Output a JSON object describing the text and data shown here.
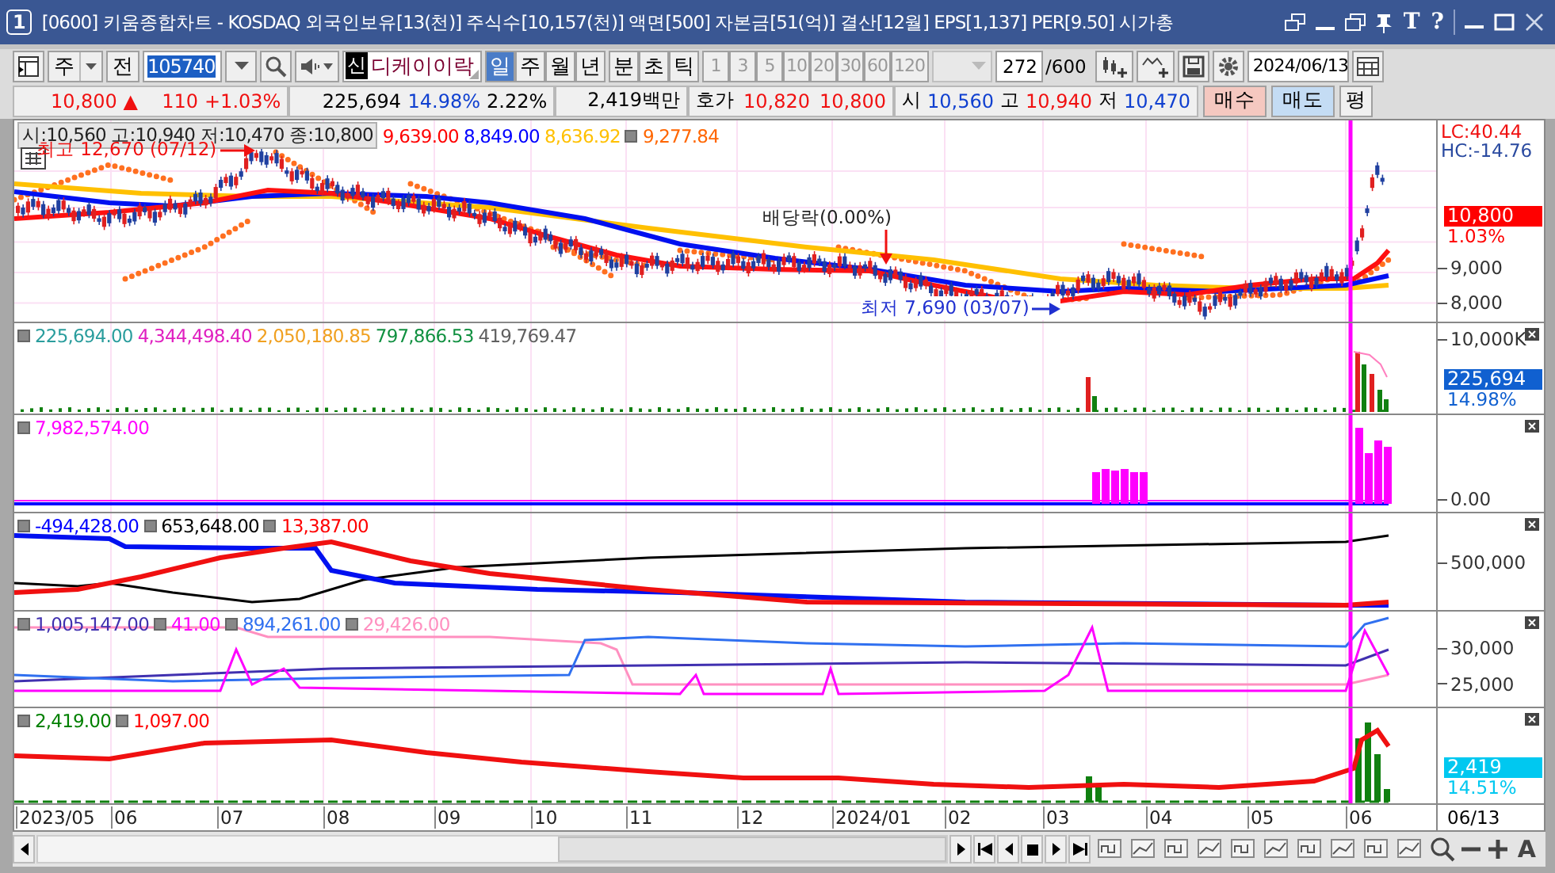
{
  "window": {
    "number": "1",
    "title": "[0600] 키움종합차트 - KOSDAQ 외국인보유[13(천)] 주식수[10,157(천)] 액면[500] 자본금[51(억)] 결산[12월] EPS[1,137] PER[9.50] 시가총",
    "title_buttons": [
      "T",
      "?"
    ]
  },
  "toolbar": {
    "period_type": "주",
    "prev": "전",
    "code": "105740",
    "name_tag": "신",
    "stock_name": "디케이이락",
    "periods": [
      {
        "label": "일",
        "selected": true
      },
      {
        "label": "주",
        "selected": false
      },
      {
        "label": "월",
        "selected": false
      },
      {
        "label": "년",
        "selected": false
      }
    ],
    "units": [
      "분",
      "초",
      "틱"
    ],
    "intervals": [
      "1",
      "3",
      "5",
      "10",
      "20",
      "30",
      "60",
      "120"
    ],
    "count": "272",
    "total": "/600",
    "date": "2024/06/13"
  },
  "quote": {
    "price": "10,800",
    "arrow": "▲",
    "change": "110",
    "change_rate": "+1.03%",
    "volume": "225,694",
    "volume_rate": "14.98%",
    "turnover": "2.22%",
    "amount": "2,419백만",
    "ask_label": "호가",
    "ask": "10,820",
    "bid": "10,800",
    "open_label": "시",
    "open": "10,560",
    "high_label": "고",
    "high": "10,940",
    "low_label": "저",
    "low": "10,470",
    "buy": "매수",
    "sell": "매도",
    "eval": "평"
  },
  "panes": [
    {
      "kind": "price",
      "ohlc": "시:10,560 고:10,940 저:10,470 종:10,800",
      "legends": [
        {
          "text": "9,639.00",
          "color": "#ff0000",
          "marker": false
        },
        {
          "text": "8,849.00",
          "color": "#0000ff",
          "marker": false
        },
        {
          "text": "8,636.92",
          "color": "#ffc000",
          "marker": false
        },
        {
          "text": "9,277.84",
          "color": "#ff6600",
          "marker": true
        }
      ],
      "annotations": [
        {
          "kind": "high",
          "text": "최고 12,670 (07/12)"
        },
        {
          "kind": "dividend",
          "text": "배당락(0.00%)"
        },
        {
          "kind": "low",
          "text": "최저 7,690 (03/07)"
        }
      ],
      "corner": [
        "LC:40.44",
        "HC:-14.76"
      ],
      "axis": [
        "9,000",
        "8,000"
      ],
      "badge": {
        "value": "10,800",
        "rate": "1.03%",
        "color": "#ff0000"
      }
    },
    {
      "kind": "volume",
      "legends": [
        {
          "text": "225,694.00",
          "color": "#2a9d9d",
          "marker": true
        },
        {
          "text": "4,344,498.40",
          "color": "#e020c0",
          "marker": false
        },
        {
          "text": "2,050,180.85",
          "color": "#f0a020",
          "marker": false
        },
        {
          "text": "797,866.53",
          "color": "#109040",
          "marker": false
        },
        {
          "text": "419,769.47",
          "color": "#606060",
          "marker": false
        }
      ],
      "axis": [
        "10,000K"
      ],
      "badge": {
        "value": "225,694",
        "rate": "14.98%",
        "color": "#1060d0"
      }
    },
    {
      "kind": "bars",
      "legends": [
        {
          "text": "7,982,574.00",
          "color": "#ff00ff",
          "marker": true
        }
      ],
      "axis": [
        "0.00"
      ]
    },
    {
      "kind": "flows",
      "legends": [
        {
          "text": "-494,428.00",
          "color": "#0000ff",
          "marker": true
        },
        {
          "text": "653,648.00",
          "color": "#000000",
          "marker": true
        },
        {
          "text": "13,387.00",
          "color": "#ff0000",
          "marker": true
        }
      ],
      "axis": [
        "500,000"
      ]
    },
    {
      "kind": "holdings",
      "legends": [
        {
          "text": "1,005,147.00",
          "color": "#4030b0",
          "marker": true
        },
        {
          "text": "41.00",
          "color": "#ff00ff",
          "marker": true
        },
        {
          "text": "894,261.00",
          "color": "#3070f0",
          "marker": true
        },
        {
          "text": "29,426.00",
          "color": "#ff90c0",
          "marker": true
        }
      ],
      "axis": [
        "30,000",
        "25,000"
      ]
    },
    {
      "kind": "amount",
      "legends": [
        {
          "text": "2,419.00",
          "color": "#008000",
          "marker": true
        },
        {
          "text": "1,097.00",
          "color": "#ff0000",
          "marker": true
        }
      ],
      "badge": {
        "value": "2,419",
        "rate": "14.51%",
        "color": "#00c8f0"
      }
    }
  ],
  "dates": [
    "2023/05",
    "06",
    "07",
    "08",
    "09",
    "10",
    "11",
    "12",
    "2024/01",
    "02",
    "03",
    "04",
    "05",
    "06"
  ],
  "current_date": "06/13",
  "font_button": "A"
}
